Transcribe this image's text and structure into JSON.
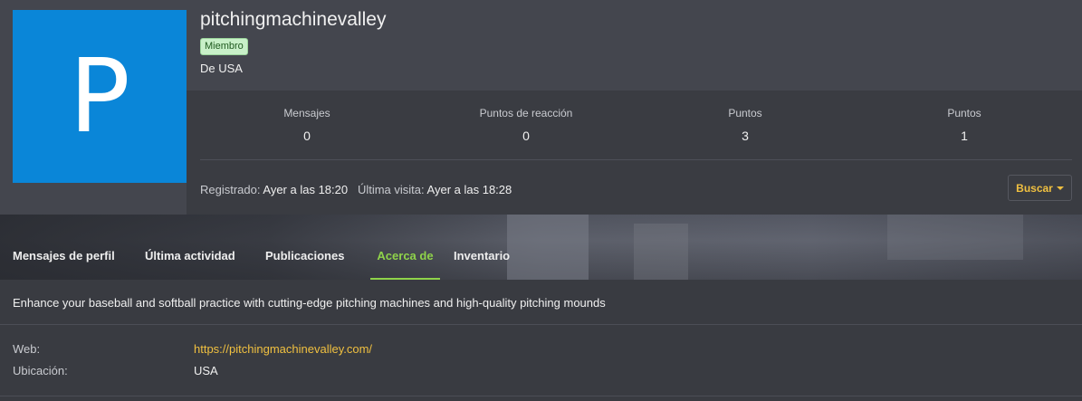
{
  "profile": {
    "avatar_letter": "P",
    "avatar_color": "#0a86d8",
    "username": "pitchingmachinevalley",
    "role_badge": "Miembro",
    "location_line": "De USA"
  },
  "stats": [
    {
      "label": "Mensajes",
      "value": "0"
    },
    {
      "label": "Puntos de reacción",
      "value": "0"
    },
    {
      "label": "Puntos",
      "value": "3"
    },
    {
      "label": "Puntos",
      "value": "1"
    }
  ],
  "activity": {
    "registered_label": "Registrado:",
    "registered_value": "Ayer a las 18:20",
    "last_seen_label": "Última visita:",
    "last_seen_value": "Ayer a las 18:28"
  },
  "search_button": {
    "label": "Buscar",
    "icon": "chevron-down-icon"
  },
  "tabs": [
    {
      "label": "Mensajes de perfil",
      "active": false
    },
    {
      "label": "Última actividad",
      "active": false
    },
    {
      "label": "Publicaciones",
      "active": false
    },
    {
      "label": "Acerca de",
      "active": true
    },
    {
      "label": "Inventario",
      "active": false
    }
  ],
  "about": {
    "bio": "Enhance your baseball and softball practice with cutting-edge pitching machines and high-quality pitching mounds",
    "fields": [
      {
        "label": "Web:",
        "value": "https://pitchingmachinevalley.com/",
        "is_link": true
      },
      {
        "label": "Ubicación:",
        "value": "USA",
        "is_link": false
      }
    ]
  },
  "colors": {
    "accent_tab": "#8fd34a",
    "link": "#f0c040",
    "badge_bg": "#c8f0c8"
  }
}
